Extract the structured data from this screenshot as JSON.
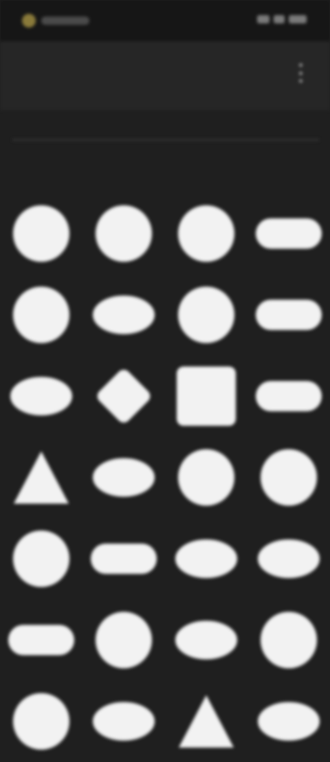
{
  "status_bar": {
    "time": "",
    "icons": [
      "signal-icon",
      "wifi-icon",
      "battery-icon"
    ]
  },
  "header": {
    "title": "",
    "menu_icon": "more-vertical-icon"
  },
  "search": {
    "placeholder": ""
  },
  "tabs": [
    {
      "label": ""
    },
    {
      "label": ""
    },
    {
      "label": ""
    },
    {
      "label": ""
    },
    {
      "label": ""
    }
  ],
  "grid": {
    "items": [
      {
        "shape": "circle"
      },
      {
        "shape": "circle"
      },
      {
        "shape": "circle"
      },
      {
        "shape": "wide"
      },
      {
        "shape": "circle"
      },
      {
        "shape": "ellipse"
      },
      {
        "shape": "circle"
      },
      {
        "shape": "wide"
      },
      {
        "shape": "ellipse"
      },
      {
        "shape": "diamond"
      },
      {
        "shape": "square"
      },
      {
        "shape": "wide"
      },
      {
        "shape": "triangle"
      },
      {
        "shape": "ellipse"
      },
      {
        "shape": "circle"
      },
      {
        "shape": "circle"
      },
      {
        "shape": "circle"
      },
      {
        "shape": "wide"
      },
      {
        "shape": "ellipse"
      },
      {
        "shape": "ellipse"
      },
      {
        "shape": "wide"
      },
      {
        "shape": "circle"
      },
      {
        "shape": "ellipse"
      },
      {
        "shape": "circle"
      },
      {
        "shape": "circle"
      },
      {
        "shape": "ellipse"
      },
      {
        "shape": "triangle"
      },
      {
        "shape": "ellipse"
      }
    ]
  },
  "colors": {
    "background": "#1f1f1f",
    "header": "#262626",
    "shape": "#f2f2f2"
  }
}
